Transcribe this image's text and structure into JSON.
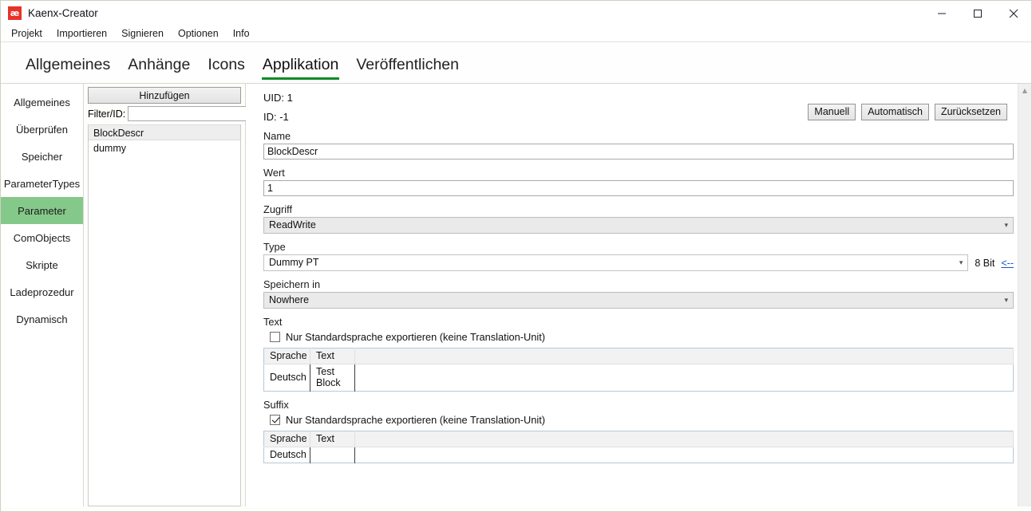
{
  "window": {
    "title": "Kaenx-Creator",
    "icon_glyph": "æ",
    "controls": {
      "minimize": "minimize-icon",
      "maximize": "maximize-icon",
      "close": "close-icon"
    }
  },
  "menubar": {
    "items": [
      "Projekt",
      "Importieren",
      "Signieren",
      "Optionen",
      "Info"
    ]
  },
  "tabs": {
    "items": [
      "Allgemeines",
      "Anhänge",
      "Icons",
      "Applikation",
      "Veröffentlichen"
    ],
    "active": "Applikation",
    "accent_color": "#0a8a28"
  },
  "sidebar": {
    "items": [
      "Allgemeines",
      "Überprüfen",
      "Speicher",
      "ParameterTypes",
      "Parameter",
      "ComObjects",
      "Skripte",
      "Ladeprozedur",
      "Dynamisch"
    ],
    "active": "Parameter",
    "active_color": "#85c98a"
  },
  "listpanel": {
    "add_label": "Hinzufügen",
    "filter_label": "Filter/ID:",
    "filter_value": "",
    "filter_placeholder": "",
    "items": [
      "BlockDescr",
      "dummy"
    ],
    "selected": "BlockDescr"
  },
  "detail": {
    "uid": "UID: 1",
    "id": "ID: -1",
    "buttons": [
      "Manuell",
      "Automatisch",
      "Zurücksetzen"
    ],
    "fields": {
      "name": {
        "label": "Name",
        "value": "BlockDescr"
      },
      "wert": {
        "label": "Wert",
        "value": "1"
      },
      "zugriff": {
        "label": "Zugriff",
        "value": "ReadWrite"
      },
      "type": {
        "label": "Type",
        "value": "Dummy PT",
        "bits": "8 Bit",
        "link": "<--"
      },
      "speichern": {
        "label": "Speichern in",
        "value": "Nowhere"
      }
    },
    "text_section": {
      "label": "Text",
      "checkbox_label": "Nur Standardsprache exportieren (keine Translation-Unit)",
      "checked": false,
      "headers": [
        "Sprache",
        "Text"
      ],
      "rows": [
        [
          "Deutsch",
          "Test Block"
        ]
      ]
    },
    "suffix_section": {
      "label": "Suffix",
      "checkbox_label": "Nur Standardsprache exportieren (keine Translation-Unit)",
      "checked": true,
      "headers": [
        "Sprache",
        "Text"
      ],
      "rows": [
        [
          "Deutsch",
          ""
        ]
      ]
    }
  }
}
